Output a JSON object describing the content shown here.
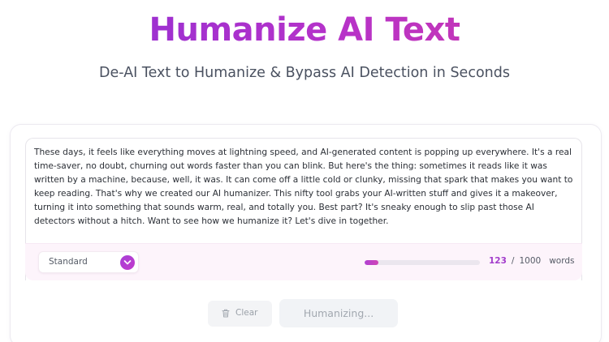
{
  "header": {
    "title": "Humanize AI Text",
    "subtitle": "De-AI Text to Humanize & Bypass AI Detection in Seconds"
  },
  "editor": {
    "text": "These days, it feels like everything moves at lightning speed, and AI-generated content is popping up everywhere. It's a real time-saver, no doubt, churning out words faster than you can blink. But here's the thing: sometimes it reads like it was written by a machine, because, well, it was. It can come off a little cold or clunky, missing that spark that makes you want to keep reading. That's why we created our AI humanizer. This nifty tool grabs your AI-written stuff and gives it a makeover, turning it into something that sounds warm, real, and totally you. Best part? It's sneaky enough to slip past those AI detectors without a hitch. Want to see how we humanize it? Let's dive in together."
  },
  "toolbar": {
    "mode_selected": "Standard",
    "word_count": "123",
    "separator": "/",
    "word_limit": "1000",
    "words_label": "words",
    "progress_fraction": 0.123
  },
  "actions": {
    "clear_label": "Clear",
    "humanize_label": "Humanizing..."
  },
  "colors": {
    "accent": "#a23ccb",
    "title_gradient_start": "#8b2fd6",
    "title_gradient_end": "#d03aa8"
  },
  "icons": {
    "mode_dropdown": "chevron-down-icon",
    "clear": "trash-icon"
  }
}
